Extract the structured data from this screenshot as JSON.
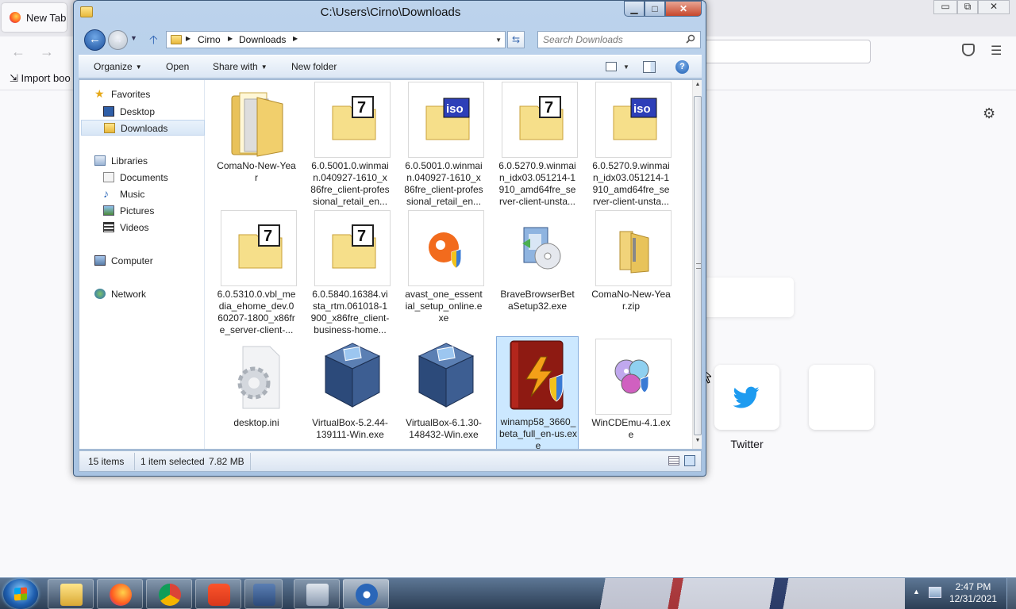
{
  "browser": {
    "tab_title": "New Tab",
    "bookmarks_import": "Import boo",
    "twitter_label": "Twitter"
  },
  "explorer": {
    "title": "C:\\Users\\Cirno\\Downloads",
    "breadcrumbs": [
      "Cirno",
      "Downloads"
    ],
    "search_placeholder": "Search Downloads",
    "toolbar": {
      "organize": "Organize",
      "open": "Open",
      "share_with": "Share with",
      "new_folder": "New folder"
    },
    "nav": {
      "favorites": "Favorites",
      "desktop": "Desktop",
      "downloads": "Downloads",
      "libraries": "Libraries",
      "documents": "Documents",
      "music": "Music",
      "pictures": "Pictures",
      "videos": "Videos",
      "computer": "Computer",
      "network": "Network"
    },
    "files": [
      {
        "name": "ComaNo-New-Year",
        "icon": "folder-icon"
      },
      {
        "name": "6.0.5001.0.winmain.040927-1610_x86fre_client-professional_retail_en...",
        "icon": "archive-7z-icon"
      },
      {
        "name": "6.0.5001.0.winmain.040927-1610_x86fre_client-professional_retail_en...",
        "icon": "iso-icon"
      },
      {
        "name": "6.0.5270.9.winmain_idx03.051214-1910_amd64fre_server-client-unsta...",
        "icon": "archive-7z-icon"
      },
      {
        "name": "6.0.5270.9.winmain_idx03.051214-1910_amd64fre_server-client-unsta...",
        "icon": "iso-icon"
      },
      {
        "name": "6.0.5310.0.vbl_media_ehome_dev.060207-1800_x86fre_server-client-...",
        "icon": "archive-7z-icon"
      },
      {
        "name": "6.0.5840.16384.vista_rtm.061018-1900_x86fre_client-business-home...",
        "icon": "archive-7z-icon"
      },
      {
        "name": "avast_one_essential_setup_online.exe",
        "icon": "avast-icon"
      },
      {
        "name": "BraveBrowserBetaSetup32.exe",
        "icon": "installer-icon"
      },
      {
        "name": "ComaNo-New-Year.zip",
        "icon": "zip-folder-icon"
      },
      {
        "name": "desktop.ini",
        "icon": "settings-file-icon"
      },
      {
        "name": "VirtualBox-5.2.44-139111-Win.exe",
        "icon": "virtualbox-icon"
      },
      {
        "name": "VirtualBox-6.1.30-148432-Win.exe",
        "icon": "virtualbox-icon"
      },
      {
        "name": "winamp58_3660_beta_full_en-us.exe",
        "icon": "winamp-icon"
      },
      {
        "name": "WinCDEmu-4.1.exe",
        "icon": "wincdemu-icon"
      }
    ],
    "selected_file_index": 13,
    "status": {
      "item_count": "15 items",
      "selection": "1 item selected",
      "size": "7.82 MB"
    }
  },
  "taskbar": {
    "apps": [
      "explorer-icon",
      "firefox-icon",
      "chrome-icon",
      "brave-beta-icon",
      "virtualbox-icon",
      "task-manager-icon",
      "settings-app-icon"
    ],
    "time": "2:47 PM",
    "date": "12/31/2021"
  },
  "colors": {
    "selection_bg": "#cce8ff",
    "selection_border": "#84acdd",
    "window_chrome": "#bcd3ec",
    "close_button": "#c7472c",
    "taskbar": "#2c3e55"
  }
}
